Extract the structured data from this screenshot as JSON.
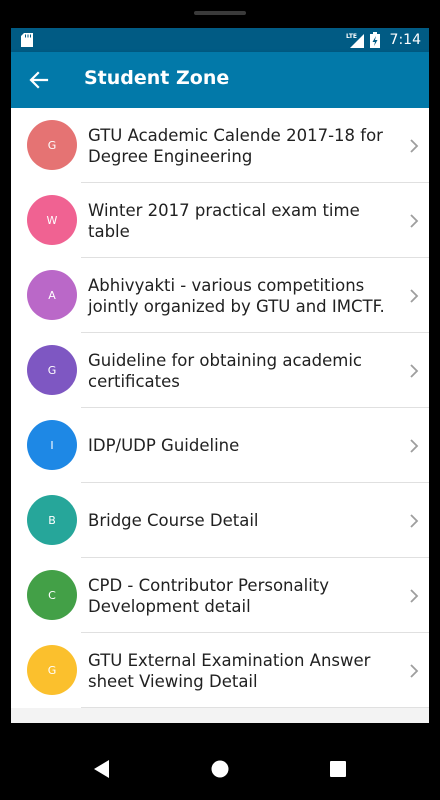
{
  "status_bar": {
    "time": "7:14",
    "network_label": "LTE"
  },
  "app_bar": {
    "title": "Student Zone"
  },
  "items": [
    {
      "letter": "G",
      "text": "GTU Academic Calende 2017-18 for Degree Engineering",
      "color": "#e57373"
    },
    {
      "letter": "W",
      "text": "Winter 2017 practical exam time table",
      "color": "#f06292"
    },
    {
      "letter": "A",
      "text": "Abhivyakti - various competitions jointly organized by GTU and IMCTF.",
      "color": "#ba68c8"
    },
    {
      "letter": "G",
      "text": "Guideline for obtaining academic certificates",
      "color": "#7e57c2"
    },
    {
      "letter": "I",
      "text": "IDP/UDP Guideline",
      "color": "#1e88e5"
    },
    {
      "letter": "B",
      "text": "Bridge Course Detail",
      "color": "#26a69a"
    },
    {
      "letter": "C",
      "text": "CPD - Contributor Personality Development detail",
      "color": "#43a047"
    },
    {
      "letter": "G",
      "text": "GTU External Examination Answer sheet Viewing Detail",
      "color": "#fbc02d"
    }
  ],
  "colors": {
    "status_bar": "#015b84",
    "app_bar": "#0279a9"
  }
}
